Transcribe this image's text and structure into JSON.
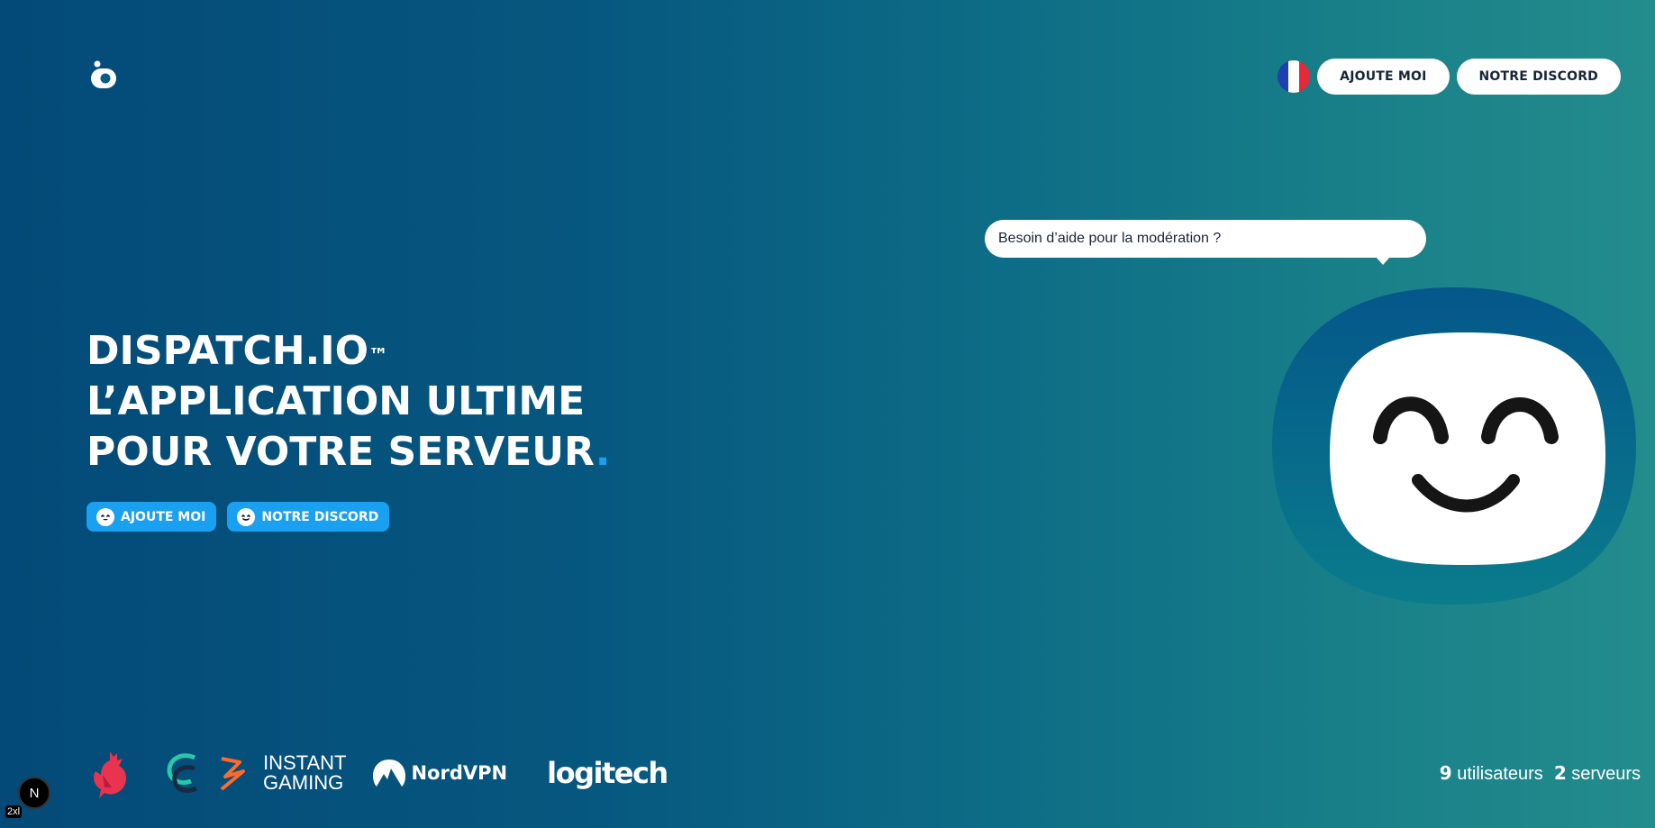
{
  "header": {
    "logo_icon": "dispatch-logo-icon",
    "language": "fr",
    "add_me_label": "AJOUTE MOI",
    "discord_label": "NOTRE DISCORD"
  },
  "hero": {
    "line1": "DISPATCH.IO",
    "trademark": "™",
    "line2": "L’APPLICATION ULTIME",
    "line3": "POUR VOTRE SERVEUR",
    "line3_dot": ".",
    "add_me_label": "AJOUTE MOI",
    "discord_label": "NOTRE DISCORD"
  },
  "mascot": {
    "speech": "Besoin d’aide pour la modération ?"
  },
  "partners": [
    {
      "name": "rooster-logo"
    },
    {
      "name": "c-logo"
    },
    {
      "name": "instant-gaming-logo",
      "text1": "INSTANT",
      "text2": "GAMING"
    },
    {
      "name": "nordvpn-logo",
      "text": "NordVPN"
    },
    {
      "name": "logitech-logo",
      "text": "logitech"
    }
  ],
  "stats": {
    "users_count": "9",
    "users_label": "utilisateurs",
    "servers_count": "2",
    "servers_label": "serveurs"
  },
  "dev": {
    "badge": "N",
    "label": "2xl"
  },
  "colors": {
    "accent_blue": "#1aa0f0",
    "bg_start": "#044a78",
    "bg_end": "#238c8c",
    "mascot_blue": "#065d8f"
  }
}
